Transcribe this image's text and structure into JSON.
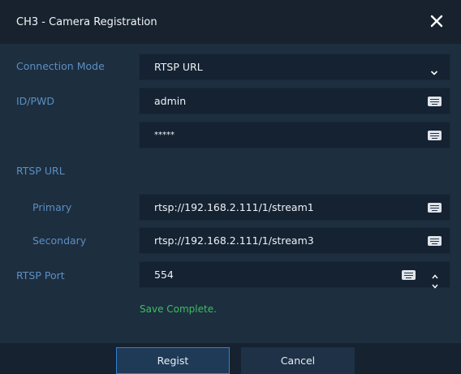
{
  "dialog": {
    "title": "CH3 - Camera Registration"
  },
  "form": {
    "connection_mode": {
      "label": "Connection Mode",
      "value": "RTSP URL"
    },
    "id_pwd": {
      "label": "ID/PWD",
      "id_value": "admin",
      "pwd_value": "*****"
    },
    "rtsp_url": {
      "label": "RTSP URL",
      "primary": {
        "label": "Primary",
        "value": "rtsp://192.168.2.111/1/stream1"
      },
      "secondary": {
        "label": "Secondary",
        "value": "rtsp://192.168.2.111/1/stream3"
      }
    },
    "rtsp_port": {
      "label": "RTSP Port",
      "value": "554"
    }
  },
  "status": {
    "text": "Save Complete.",
    "color": "#3dbd62"
  },
  "buttons": {
    "regist": "Regist",
    "cancel": "Cancel"
  },
  "icons": [
    "close-icon",
    "chevron-down-icon",
    "keyboard-icon",
    "spinner-up-icon",
    "spinner-down-icon"
  ],
  "colors": {
    "label": "#5b8fc4",
    "accent": "#2f7fd6",
    "background": "#1d2e3f"
  }
}
